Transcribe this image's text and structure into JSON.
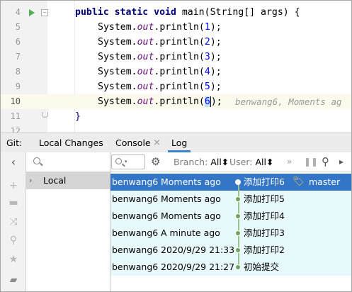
{
  "editor": {
    "lines": [
      {
        "num": "4",
        "pre": "public static void ",
        "name": "main",
        "args": "(String[] args) {"
      },
      {
        "num": "5",
        "obj": "System.",
        "field": "out",
        "call": ".println(",
        "arg": "1",
        "end": ");"
      },
      {
        "num": "6",
        "obj": "System.",
        "field": "out",
        "call": ".println(",
        "arg": "2",
        "end": ");"
      },
      {
        "num": "7",
        "obj": "System.",
        "field": "out",
        "call": ".println(",
        "arg": "3",
        "end": ");"
      },
      {
        "num": "8",
        "obj": "System.",
        "field": "out",
        "call": ".println(",
        "arg": "4",
        "end": ");"
      },
      {
        "num": "9",
        "obj": "System.",
        "field": "out",
        "call": ".println(",
        "arg": "5",
        "end": ");"
      },
      {
        "num": "10",
        "obj": "System.",
        "field": "out",
        "call": ".println(",
        "arg": "6",
        "end": ");"
      },
      {
        "num": "11",
        "text": "}"
      },
      {
        "num": "12",
        "text": ""
      }
    ],
    "inline_blame": "benwang6, Moments ag"
  },
  "vcs_window": {
    "label": "Git:",
    "tabs": [
      {
        "label": "Local Changes"
      },
      {
        "label": "Console"
      },
      {
        "label": "Log",
        "active": true
      }
    ],
    "close_glyph": "×"
  },
  "toolstrip": {
    "icons": [
      "chevron-left-icon",
      "plus-icon",
      "trash-icon",
      "merge-icon",
      "search-icon",
      "star-icon",
      "folder-icon"
    ]
  },
  "branches": {
    "search_placeholder": "",
    "node_label": "Local"
  },
  "log_toolbar": {
    "branch_label": "Branch:",
    "branch_value": "All",
    "user_label": "User:",
    "user_value": "All",
    "more_glyph": "»",
    "sort_glyph": "⬍"
  },
  "commits": [
    {
      "author": "benwang6",
      "date": "Moments ago",
      "message": "添加打印6",
      "tag": "master",
      "selected": true
    },
    {
      "author": "benwang6",
      "date": "Moments ago",
      "message": "添加打印5"
    },
    {
      "author": "benwang6",
      "date": "Moments ago",
      "message": "添加打印4"
    },
    {
      "author": "benwang6",
      "date": "A minute ago",
      "message": "添加打印3"
    },
    {
      "author": "benwang6",
      "date": "2020/9/29 21:33",
      "message": "添加打印2"
    },
    {
      "author": "benwang6",
      "date": "2020/9/29 21:27",
      "message": "初始提交"
    }
  ],
  "colors": {
    "selection": "#3375c6",
    "row_background": "#e8f9fc",
    "graph": "#6fa35e",
    "tab_underline": "#4083c9"
  }
}
